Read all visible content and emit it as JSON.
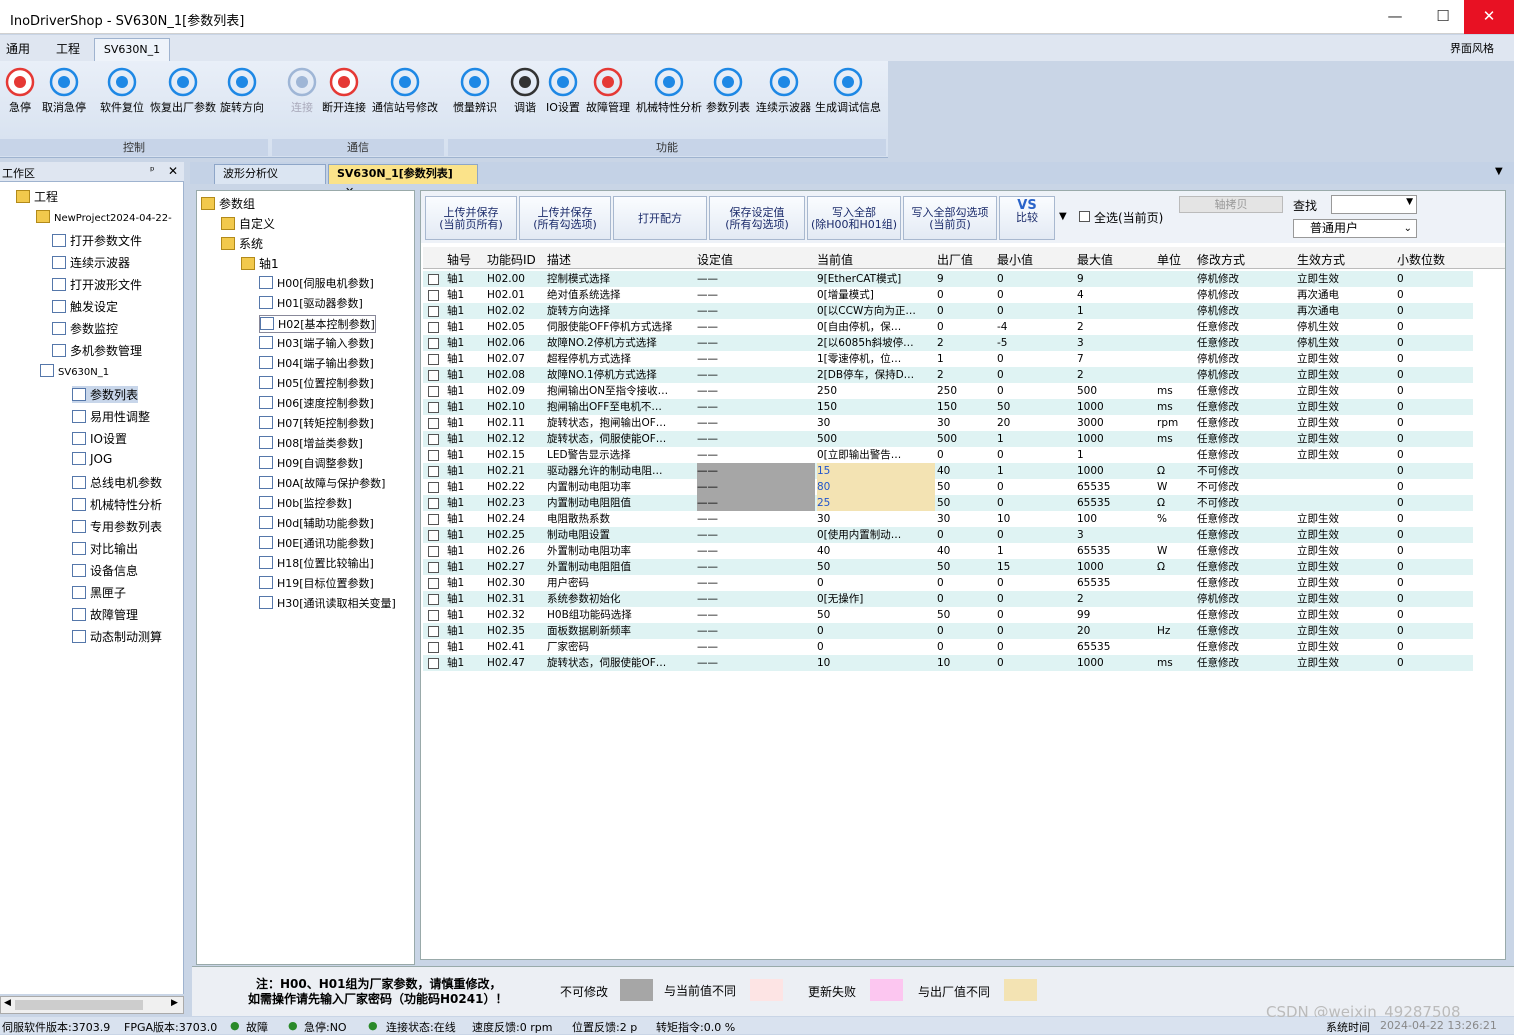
{
  "app": {
    "title": "InoDriverShop - SV630N_1[参数列表]",
    "minimize": "—",
    "maximize": "☐",
    "close": "✕"
  },
  "menu": {
    "tab1": "通用",
    "tab2": "工程",
    "tab3": "SV630N_1",
    "style": "界面风格"
  },
  "ribbon": {
    "control": [
      {
        "label": "急停",
        "icon": "stop-icon"
      },
      {
        "label": "取消急停",
        "icon": "cancel-stop-icon"
      },
      {
        "label": "软件复位",
        "icon": "reset-icon"
      },
      {
        "label": "恢复出厂参数",
        "icon": "factory-reset-icon"
      },
      {
        "label": "旋转方向",
        "icon": "rotate-icon"
      }
    ],
    "comm": [
      {
        "label": "连接",
        "icon": "connect-icon"
      },
      {
        "label": "断开连接",
        "icon": "disconnect-icon"
      },
      {
        "label": "通信站号修改",
        "icon": "edit-station-icon"
      }
    ],
    "func": [
      {
        "label": "惯量辨识",
        "icon": "inertia-icon"
      },
      {
        "label": "调谐",
        "icon": "tune-icon"
      },
      {
        "label": "IO设置",
        "icon": "io-icon"
      },
      {
        "label": "故障管理",
        "icon": "warning-icon"
      },
      {
        "label": "机械特性分析",
        "icon": "analysis-icon"
      },
      {
        "label": "参数列表",
        "icon": "param-list-icon"
      },
      {
        "label": "连续示波器",
        "icon": "scope-icon"
      },
      {
        "label": "生成调试信息",
        "icon": "debug-icon"
      }
    ],
    "groups": {
      "control": "控制",
      "comm": "通信",
      "func": "功能"
    }
  },
  "workspace": {
    "title": "工作区",
    "pin": "ᵖ",
    "close": "✕",
    "items": [
      "工程",
      "NewProject2024-04-22-",
      "打开参数文件",
      "连续示波器",
      "打开波形文件",
      "触发设定",
      "参数监控",
      "多机参数管理",
      "SV630N_1",
      "参数列表",
      "易用性调整",
      "IO设置",
      "JOG",
      "总线电机参数",
      "机械特性分析",
      "专用参数列表",
      "对比输出",
      "设备信息",
      "黑匣子",
      "故障管理",
      "动态制动测算"
    ]
  },
  "doctabs": {
    "tab1": "波形分析仪",
    "tab2": "SV630N_1[参数列表]",
    "close": "✕"
  },
  "ptree": {
    "root": "参数组",
    "custom": "自定义",
    "system": "系统",
    "axis": "轴1",
    "groups": [
      "H00[伺服电机参数]",
      "H01[驱动器参数]",
      "H02[基本控制参数]",
      "H03[端子输入参数]",
      "H04[端子输出参数]",
      "H05[位置控制参数]",
      "H06[速度控制参数]",
      "H07[转矩控制参数]",
      "H08[增益类参数]",
      "H09[自调整参数]",
      "H0A[故障与保护参数]",
      "H0b[监控参数]",
      "H0d[辅助功能参数]",
      "H0E[通讯功能参数]",
      "H18[位置比较输出]",
      "H19[目标位置参数]",
      "H30[通讯读取相关变量]"
    ]
  },
  "toolbar": {
    "b1a": "上传并保存",
    "b1b": "(当前页所有)",
    "b2a": "上传并保存",
    "b2b": "(所有勾选项)",
    "b3": "打开配方",
    "b4a": "保存设定值",
    "b4b": "(所有勾选项)",
    "b5a": "写入全部",
    "b5b": "(除H00和H01组)",
    "b6a": "写入全部勾选项",
    "b6b": "(当前页)",
    "vs": "VS",
    "compare": "比较",
    "selectall": "全选(当前页)",
    "copy": "轴拷贝",
    "search": "查找",
    "user": "普通用户"
  },
  "columns": [
    "轴号",
    "功能码ID",
    "描述",
    "设定值",
    "当前值",
    "出厂值",
    "最小值",
    "最大值",
    "单位",
    "修改方式",
    "生效方式",
    "小数位数"
  ],
  "rows": [
    [
      "轴1",
      "H02.00",
      "控制模式选择",
      "——",
      "9[EtherCAT模式]",
      "9",
      "0",
      "9",
      "",
      "停机修改",
      "立即生效",
      "0"
    ],
    [
      "轴1",
      "H02.01",
      "绝对值系统选择",
      "——",
      "0[增量模式]",
      "0",
      "0",
      "4",
      "",
      "停机修改",
      "再次通电",
      "0"
    ],
    [
      "轴1",
      "H02.02",
      "旋转方向选择",
      "——",
      "0[以CCW方向为正…",
      "0",
      "0",
      "1",
      "",
      "停机修改",
      "再次通电",
      "0"
    ],
    [
      "轴1",
      "H02.05",
      "伺服使能OFF停机方式选择",
      "——",
      "0[自由停机，保…",
      "0",
      "-4",
      "2",
      "",
      "任意修改",
      "停机生效",
      "0"
    ],
    [
      "轴1",
      "H02.06",
      "故障NO.2停机方式选择",
      "——",
      "2[以6085h斜坡停…",
      "2",
      "-5",
      "3",
      "",
      "任意修改",
      "停机生效",
      "0"
    ],
    [
      "轴1",
      "H02.07",
      "超程停机方式选择",
      "——",
      "1[零速停机，位…",
      "1",
      "0",
      "7",
      "",
      "停机修改",
      "立即生效",
      "0"
    ],
    [
      "轴1",
      "H02.08",
      "故障NO.1停机方式选择",
      "——",
      "2[DB停车，保持D…",
      "2",
      "0",
      "2",
      "",
      "停机修改",
      "立即生效",
      "0"
    ],
    [
      "轴1",
      "H02.09",
      "抱闸输出ON至指令接收…",
      "——",
      "250",
      "250",
      "0",
      "500",
      "ms",
      "任意修改",
      "立即生效",
      "0"
    ],
    [
      "轴1",
      "H02.10",
      "抱闸输出OFF至电机不…",
      "——",
      "150",
      "150",
      "50",
      "1000",
      "ms",
      "任意修改",
      "立即生效",
      "0"
    ],
    [
      "轴1",
      "H02.11",
      "旋转状态，抱闸输出OF…",
      "——",
      "30",
      "30",
      "20",
      "3000",
      "rpm",
      "任意修改",
      "立即生效",
      "0"
    ],
    [
      "轴1",
      "H02.12",
      "旋转状态，伺服使能OF…",
      "——",
      "500",
      "500",
      "1",
      "1000",
      "ms",
      "任意修改",
      "立即生效",
      "0"
    ],
    [
      "轴1",
      "H02.15",
      "LED警告显示选择",
      "——",
      "0[立即输出警告…",
      "0",
      "0",
      "1",
      "",
      "任意修改",
      "立即生效",
      "0"
    ],
    [
      "轴1",
      "H02.21",
      "驱动器允许的制动电阻…",
      "——",
      "15",
      "40",
      "1",
      "1000",
      "Ω",
      "不可修改",
      "",
      "0"
    ],
    [
      "轴1",
      "H02.22",
      "内置制动电阻功率",
      "——",
      "80",
      "50",
      "0",
      "65535",
      "W",
      "不可修改",
      "",
      "0"
    ],
    [
      "轴1",
      "H02.23",
      "内置制动电阻阻值",
      "——",
      "25",
      "50",
      "0",
      "65535",
      "Ω",
      "不可修改",
      "",
      "0"
    ],
    [
      "轴1",
      "H02.24",
      "电阻散热系数",
      "——",
      "30",
      "30",
      "10",
      "100",
      "%",
      "任意修改",
      "立即生效",
      "0"
    ],
    [
      "轴1",
      "H02.25",
      "制动电阻设置",
      "——",
      "0[使用内置制动…",
      "0",
      "0",
      "3",
      "",
      "任意修改",
      "立即生效",
      "0"
    ],
    [
      "轴1",
      "H02.26",
      "外置制动电阻功率",
      "——",
      "40",
      "40",
      "1",
      "65535",
      "W",
      "任意修改",
      "立即生效",
      "0"
    ],
    [
      "轴1",
      "H02.27",
      "外置制动电阻阻值",
      "——",
      "50",
      "50",
      "15",
      "1000",
      "Ω",
      "任意修改",
      "立即生效",
      "0"
    ],
    [
      "轴1",
      "H02.30",
      "用户密码",
      "——",
      "0",
      "0",
      "0",
      "65535",
      "",
      "任意修改",
      "立即生效",
      "0"
    ],
    [
      "轴1",
      "H02.31",
      "系统参数初始化",
      "——",
      "0[无操作]",
      "0",
      "0",
      "2",
      "",
      "停机修改",
      "立即生效",
      "0"
    ],
    [
      "轴1",
      "H02.32",
      "H0B组功能码选择",
      "——",
      "50",
      "50",
      "0",
      "99",
      "",
      "任意修改",
      "立即生效",
      "0"
    ],
    [
      "轴1",
      "H02.35",
      "面板数据刷新频率",
      "——",
      "0",
      "0",
      "0",
      "20",
      "Hz",
      "任意修改",
      "立即生效",
      "0"
    ],
    [
      "轴1",
      "H02.41",
      "厂家密码",
      "——",
      "0",
      "0",
      "0",
      "65535",
      "",
      "任意修改",
      "立即生效",
      "0"
    ],
    [
      "轴1",
      "H02.47",
      "旋转状态，伺服使能OF…",
      "——",
      "10",
      "10",
      "0",
      "1000",
      "ms",
      "任意修改",
      "立即生效",
      "0"
    ]
  ],
  "legend": {
    "note1": "注：H00、H01组为厂家参数，请慎重修改，",
    "note2": "如需操作请先输入厂家密码（功能码H0241）！",
    "l1": "不可修改",
    "l2": "与当前值不同",
    "l3": "更新失败",
    "l4": "与出厂值不同"
  },
  "status": {
    "s1": "伺服软件版本:3703.9",
    "s2": "FPGA版本:3703.0",
    "s3": "故障",
    "s4": "急停:NO",
    "s5": "连接状态:在线",
    "s6": "速度反馈:0 rpm",
    "s7": "位置反馈:2 p",
    "s8": "转矩指令:0.0 %",
    "s9": "系统时间",
    "s10": "2024-04-22 13:26:21",
    "wm": "CSDN @weixin_49287508"
  },
  "colors": {
    "row_alt": "#dff3f3",
    "noedit": "#a6a6a6",
    "diffcur": "#fde4e4",
    "fail": "#fcc6f0",
    "difffac": "#f3e3b3"
  }
}
